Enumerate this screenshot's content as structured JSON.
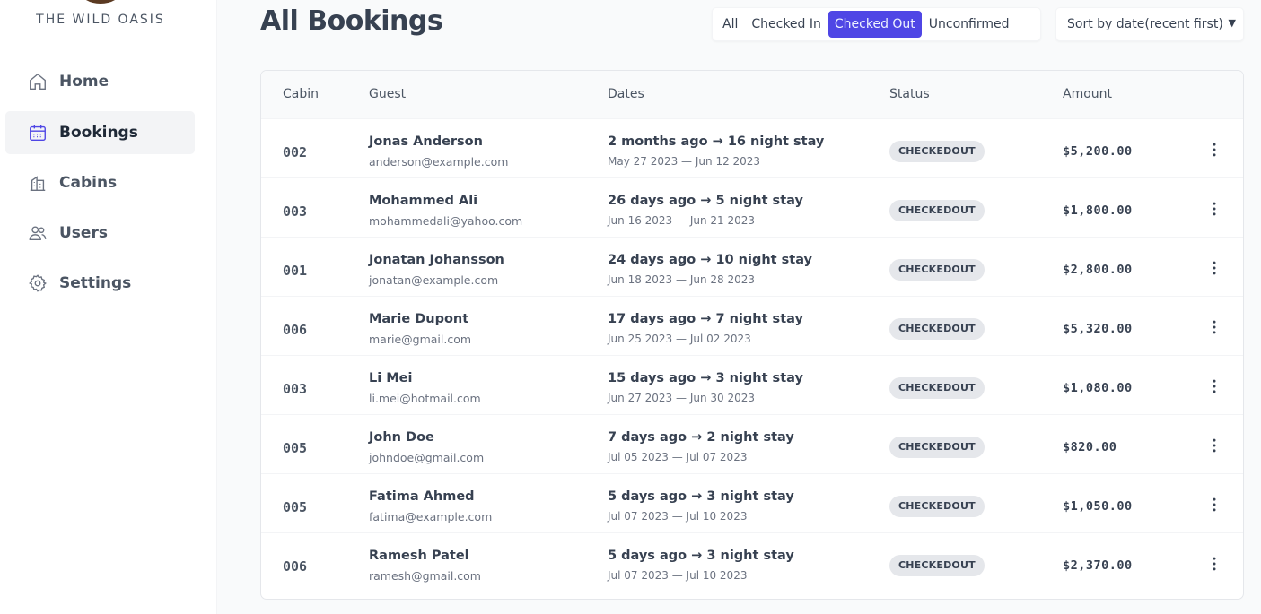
{
  "brand": {
    "name": "THE WILD OASIS"
  },
  "nav": [
    {
      "label": "Home",
      "icon": "home-icon",
      "active": false
    },
    {
      "label": "Bookings",
      "icon": "calendar-icon",
      "active": true
    },
    {
      "label": "Cabins",
      "icon": "building-icon",
      "active": false
    },
    {
      "label": "Users",
      "icon": "users-icon",
      "active": false
    },
    {
      "label": "Settings",
      "icon": "gear-icon",
      "active": false
    }
  ],
  "page": {
    "title": "All Bookings"
  },
  "filters": {
    "options": [
      "All",
      "Checked In",
      "Checked Out",
      "Unconfirmed"
    ],
    "active": "Checked Out"
  },
  "sort": {
    "selected": "Sort by date(recent first)"
  },
  "table": {
    "headers": [
      "Cabin",
      "Guest",
      "Dates",
      "Status",
      "Amount"
    ],
    "rows": [
      {
        "cabin": "002",
        "name": "Jonas Anderson",
        "email": "anderson@example.com",
        "dates": "2 months ago → 16 night stay",
        "range": "May 27 2023 — Jun 12 2023",
        "status": "CHECKEDOUT",
        "amount": "$5,200.00"
      },
      {
        "cabin": "003",
        "name": "Mohammed Ali",
        "email": "mohammedali@yahoo.com",
        "dates": "26 days ago → 5 night stay",
        "range": "Jun 16 2023 — Jun 21 2023",
        "status": "CHECKEDOUT",
        "amount": "$1,800.00"
      },
      {
        "cabin": "001",
        "name": "Jonatan Johansson",
        "email": "jonatan@example.com",
        "dates": "24 days ago → 10 night stay",
        "range": "Jun 18 2023 — Jun 28 2023",
        "status": "CHECKEDOUT",
        "amount": "$2,800.00"
      },
      {
        "cabin": "006",
        "name": "Marie Dupont",
        "email": "marie@gmail.com",
        "dates": "17 days ago → 7 night stay",
        "range": "Jun 25 2023 — Jul 02 2023",
        "status": "CHECKEDOUT",
        "amount": "$5,320.00"
      },
      {
        "cabin": "003",
        "name": "Li Mei",
        "email": "li.mei@hotmail.com",
        "dates": "15 days ago → 3 night stay",
        "range": "Jun 27 2023 — Jun 30 2023",
        "status": "CHECKEDOUT",
        "amount": "$1,080.00"
      },
      {
        "cabin": "005",
        "name": "John Doe",
        "email": "johndoe@gmail.com",
        "dates": "7 days ago → 2 night stay",
        "range": "Jul 05 2023 — Jul 07 2023",
        "status": "CHECKEDOUT",
        "amount": "$820.00"
      },
      {
        "cabin": "005",
        "name": "Fatima Ahmed",
        "email": "fatima@example.com",
        "dates": "5 days ago → 3 night stay",
        "range": "Jul 07 2023 — Jul 10 2023",
        "status": "CHECKEDOUT",
        "amount": "$1,050.00"
      },
      {
        "cabin": "006",
        "name": "Ramesh Patel",
        "email": "ramesh@gmail.com",
        "dates": "5 days ago → 3 night stay",
        "range": "Jul 07 2023 — Jul 10 2023",
        "status": "CHECKEDOUT",
        "amount": "$2,370.00"
      }
    ]
  },
  "colors": {
    "accent": "#4f46e5",
    "status_bg": "#e5e7eb"
  }
}
